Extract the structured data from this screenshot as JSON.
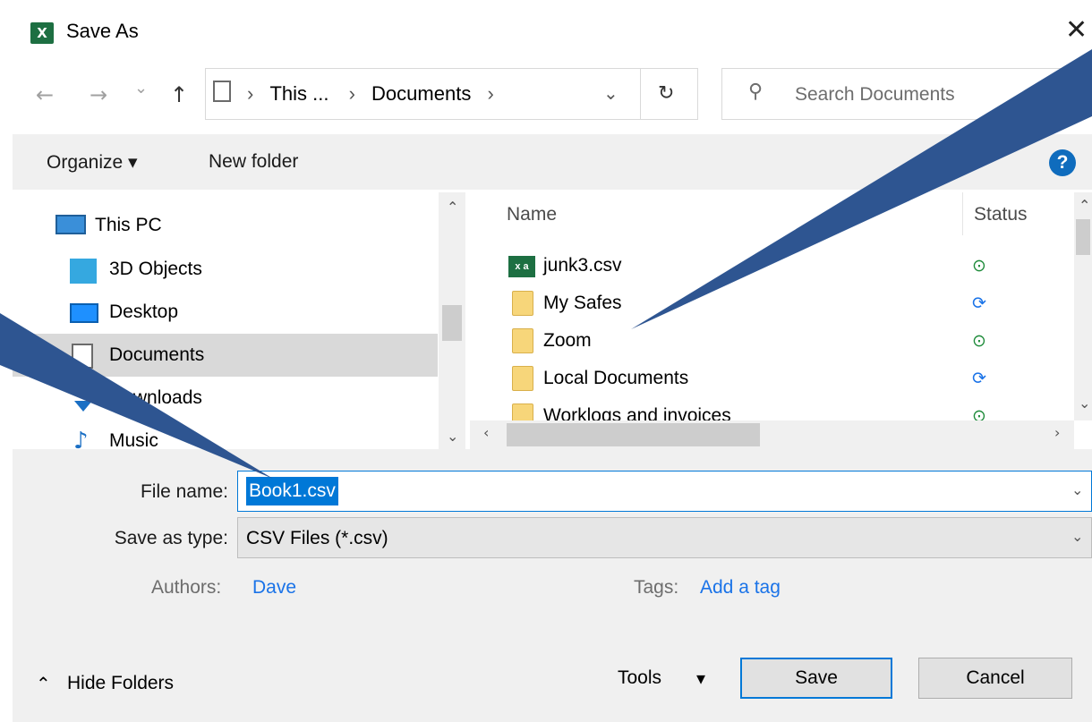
{
  "window": {
    "app_icon": "excel-icon",
    "title": "Save As",
    "close_glyph": "✕"
  },
  "nav": {
    "back_glyph": "←",
    "forward_glyph": "→",
    "recent_glyph": "⌄",
    "up_glyph": "↑",
    "breadcrumb": [
      "This ...",
      "Documents"
    ],
    "breadcrumb_sep": "›",
    "dropdown_glyph": "⌄",
    "refresh_glyph": "↻",
    "search_placeholder": "Search Documents",
    "search_icon": "⚲"
  },
  "toolbar": {
    "organize_label": "Organize ▾",
    "new_folder_label": "New folder",
    "view_glyph": "▾",
    "help_label": "?"
  },
  "sidebar": {
    "items": [
      {
        "label": "This PC",
        "icon": "computer-icon"
      },
      {
        "label": "3D Objects",
        "icon": "cube-icon"
      },
      {
        "label": "Desktop",
        "icon": "desktop-icon"
      },
      {
        "label": "Documents",
        "icon": "document-icon"
      },
      {
        "label": "Downloads",
        "icon": "download-icon"
      },
      {
        "label": "Music",
        "icon": "music-icon"
      }
    ],
    "selected": "Documents"
  },
  "file_list": {
    "columns": [
      "Name",
      "Status"
    ],
    "rows": [
      {
        "name": "junk3.csv",
        "type": "csv",
        "status": "synced"
      },
      {
        "name": "My Safes",
        "type": "folder",
        "status": "syncing"
      },
      {
        "name": "Zoom",
        "type": "folder",
        "status": "synced"
      },
      {
        "name": "Local Documents",
        "type": "folder",
        "status": "syncing"
      },
      {
        "name": "Worklogs and invoices",
        "type": "folder",
        "status": "synced"
      }
    ],
    "status_glyphs": {
      "synced": "⊙",
      "syncing": "⟳"
    },
    "colors": {
      "synced": "#1e8b3a",
      "syncing": "#1a73e8"
    }
  },
  "form": {
    "file_name_label": "File name:",
    "file_name_value": "Book1.csv",
    "save_type_label": "Save as type:",
    "save_type_value": "CSV Files (*.csv)",
    "authors_label": "Authors:",
    "authors_value": "Dave",
    "tags_label": "Tags:",
    "tags_value": "Add a tag"
  },
  "footer": {
    "hide_folders_label": "Hide Folders",
    "hide_glyph": "⌃",
    "tools_label": "Tools",
    "tools_glyph": "▾",
    "save_label": "Save",
    "cancel_label": "Cancel"
  },
  "colors": {
    "accent": "#0078d7",
    "callout": "#2e5591",
    "excel": "#1d6f42"
  }
}
